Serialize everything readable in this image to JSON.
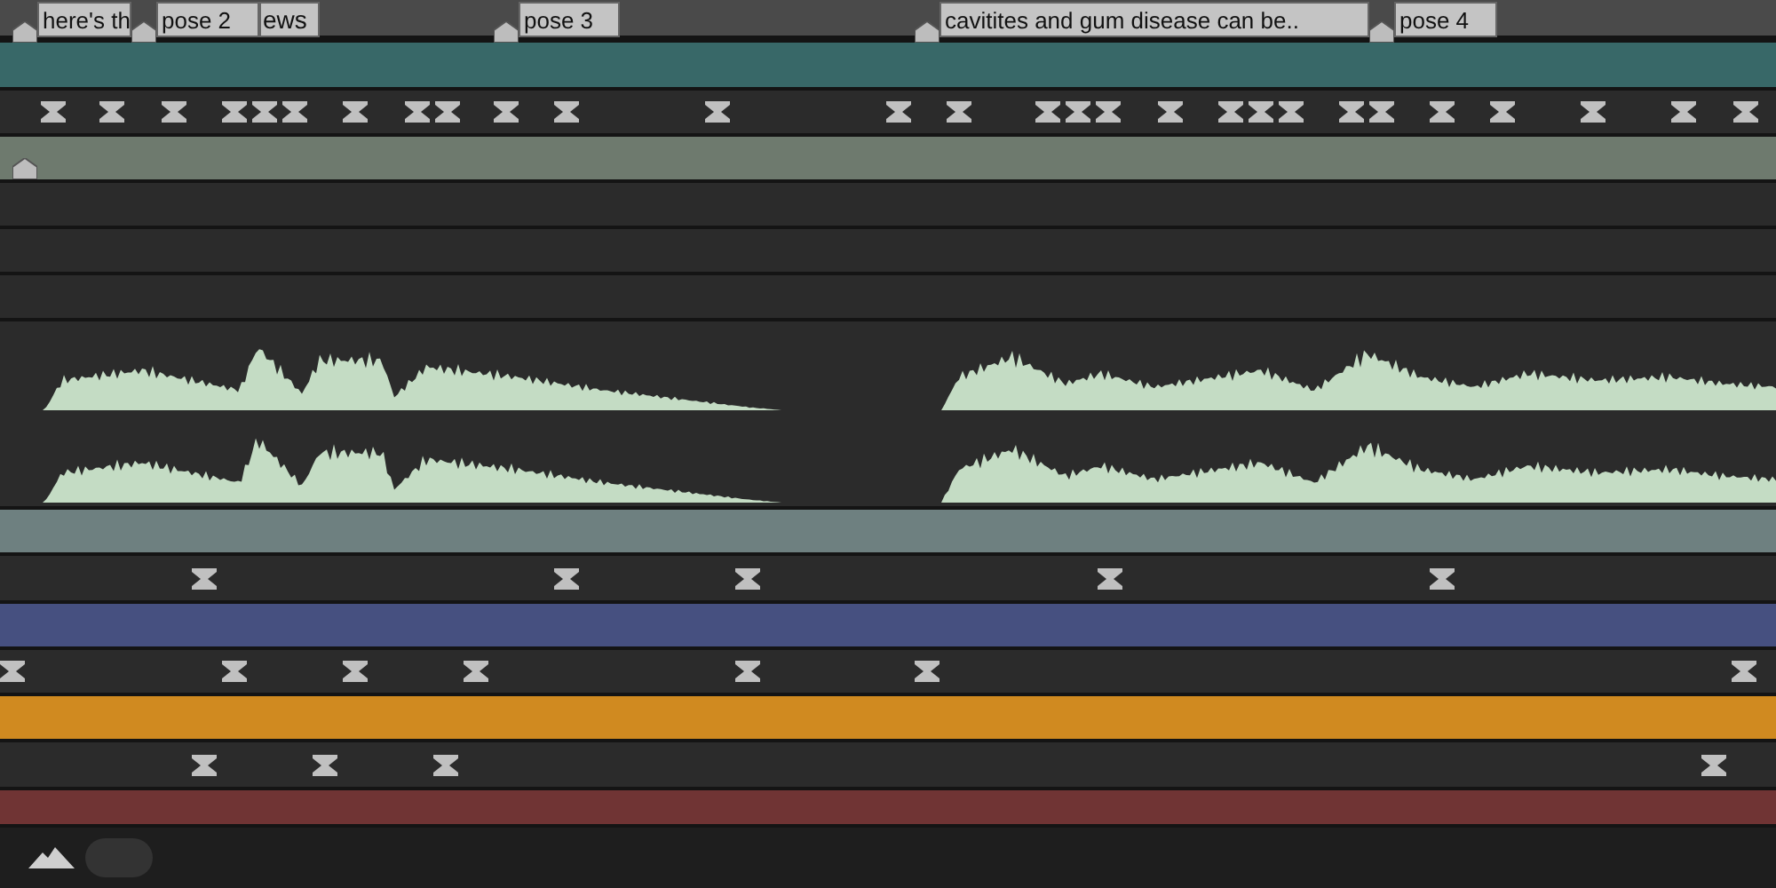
{
  "markers": [
    {
      "label": "here's th",
      "tail": "ews"
    },
    {
      "label": "pose 2"
    },
    {
      "label": "pose 3"
    },
    {
      "label": "cavitites and gum disease can be.."
    },
    {
      "label": "pose 4"
    }
  ],
  "layers": [
    {
      "kind": "bar",
      "color": "#386868"
    },
    {
      "kind": "keys"
    },
    {
      "kind": "bar",
      "color": "#6e7a6e"
    },
    {
      "kind": "empty"
    },
    {
      "kind": "empty"
    },
    {
      "kind": "empty"
    },
    {
      "kind": "audio"
    },
    {
      "kind": "bar",
      "color": "#6e8080"
    },
    {
      "kind": "keys"
    },
    {
      "kind": "bar",
      "color": "#465080"
    },
    {
      "kind": "keys"
    },
    {
      "kind": "bar",
      "color": "#d08a20"
    },
    {
      "kind": "keys"
    },
    {
      "kind": "bar",
      "color": "#703434"
    }
  ]
}
